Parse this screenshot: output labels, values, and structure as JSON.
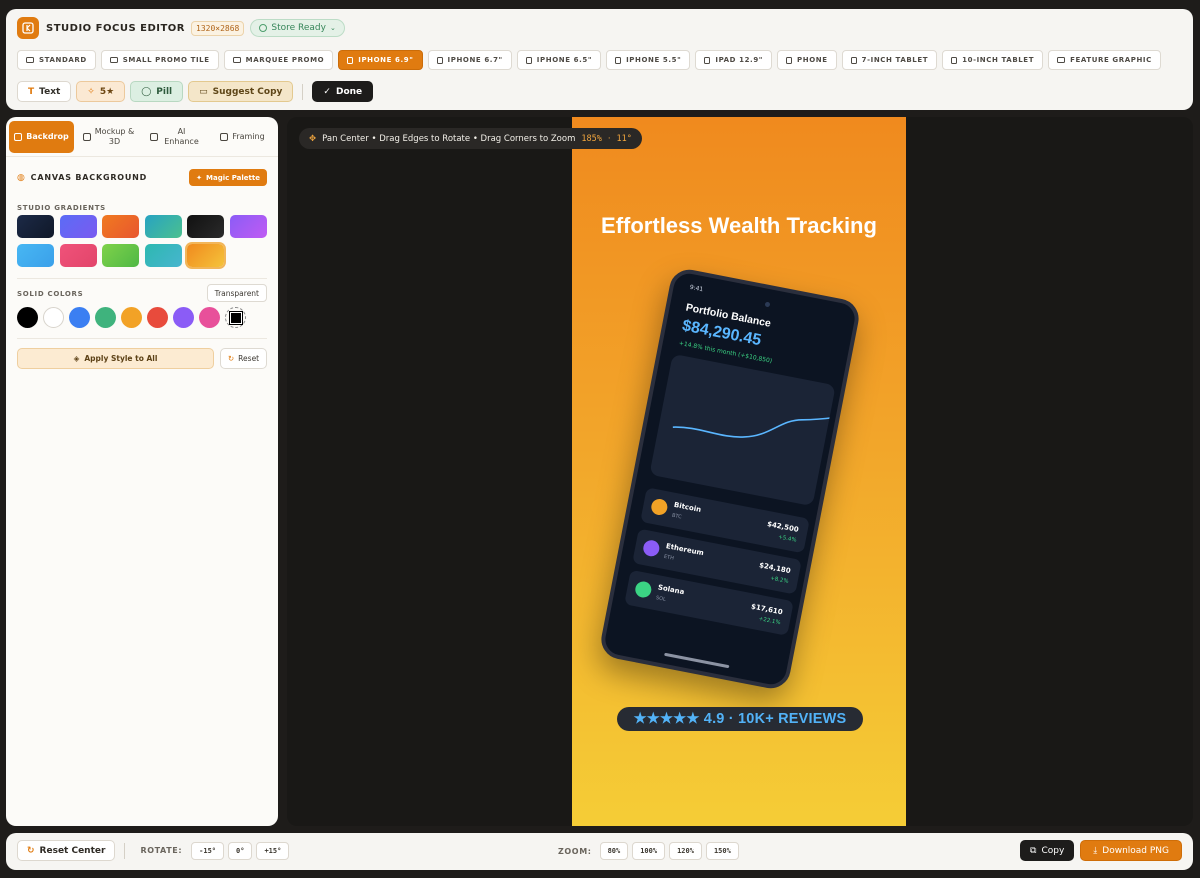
{
  "app": {
    "title": "STUDIO FOCUS EDITOR",
    "dimensions": "1320×2868",
    "store_status": "Store Ready"
  },
  "presets": [
    {
      "label": "STANDARD",
      "icon": "monitor-icon",
      "active": false
    },
    {
      "label": "SMALL PROMO TILE",
      "icon": "monitor-icon",
      "active": false
    },
    {
      "label": "MARQUEE PROMO",
      "icon": "monitor-icon",
      "active": false
    },
    {
      "label": "IPHONE 6.9\"",
      "icon": "phone-icon",
      "active": true
    },
    {
      "label": "IPHONE 6.7\"",
      "icon": "phone-icon",
      "active": false
    },
    {
      "label": "IPHONE 6.5\"",
      "icon": "phone-icon",
      "active": false
    },
    {
      "label": "IPHONE 5.5\"",
      "icon": "phone-icon",
      "active": false
    },
    {
      "label": "IPAD 12.9\"",
      "icon": "tablet-icon",
      "active": false
    },
    {
      "label": "PHONE",
      "icon": "phone-icon",
      "active": false
    },
    {
      "label": "7-INCH TABLET",
      "icon": "phone-icon",
      "active": false
    },
    {
      "label": "10-INCH TABLET",
      "icon": "phone-icon",
      "active": false
    },
    {
      "label": "FEATURE GRAPHIC",
      "icon": "monitor-icon",
      "active": false
    }
  ],
  "toolbar": {
    "text": "Text",
    "rating": "5★",
    "pill": "Pill",
    "suggest_copy": "Suggest Copy",
    "done": "Done"
  },
  "sidebar": {
    "tabs": [
      {
        "label": "Backdrop",
        "icon": "palette-icon",
        "active": true
      },
      {
        "label": "Mockup & 3D",
        "icon": "phone-icon",
        "active": false
      },
      {
        "label": "AI Enhance",
        "icon": "lightning-icon",
        "active": false
      },
      {
        "label": "Framing",
        "icon": "frame-icon",
        "active": false
      }
    ],
    "section_title": "CANVAS BACKGROUND",
    "magic_palette": "Magic Palette",
    "gradients_label": "STUDIO GRADIENTS",
    "gradients": [
      {
        "from": "#1c2a47",
        "to": "#101828",
        "selected": false
      },
      {
        "from": "#5b6cf6",
        "to": "#7a5af0",
        "selected": false
      },
      {
        "from": "#f07a20",
        "to": "#e8562f",
        "selected": false
      },
      {
        "from": "#27a3c2",
        "to": "#4bc08f",
        "selected": false
      },
      {
        "from": "#111",
        "to": "#2a2a2a",
        "selected": false
      },
      {
        "from": "#8b5cf6",
        "to": "#c05bf3",
        "selected": false
      },
      {
        "from": "#48b7f3",
        "to": "#3aa0ea",
        "selected": false
      },
      {
        "from": "#f0527a",
        "to": "#e2456a",
        "selected": false
      },
      {
        "from": "#7fd24a",
        "to": "#4fb845",
        "selected": false
      },
      {
        "from": "#2db8b0",
        "to": "#47b5cf",
        "selected": false
      },
      {
        "from": "#f08a1e",
        "to": "#f5c33a",
        "selected": true
      }
    ],
    "solid_label": "SOLID COLORS",
    "transparent": "Transparent",
    "solid_colors": [
      "#000000",
      "#ffffff",
      "#3b7ff2",
      "#3fb37d",
      "#f2a226",
      "#e84b3c",
      "#8b5cf6",
      "#e8509a"
    ],
    "apply_all": "Apply Style to All",
    "reset": "Reset"
  },
  "canvas": {
    "hint": "Pan Center • Drag Edges to Rotate • Drag Corners to Zoom",
    "zoom": "185%",
    "separator": "·",
    "rotation": "11°",
    "headline": "Effortless Wealth Tracking",
    "phone": {
      "time": "9:41",
      "title": "Portfolio Balance",
      "amount": "$84,290.45",
      "change": "+14.8% this month (+$10,850)",
      "coins": [
        {
          "name": "Bitcoin",
          "symbol": "BTC",
          "value": "$42,500",
          "change": "+5.4%",
          "color": "#f2a226"
        },
        {
          "name": "Ethereum",
          "symbol": "ETH",
          "value": "$24,180",
          "change": "+8.2%",
          "color": "#8b5cf6"
        },
        {
          "name": "Solana",
          "symbol": "SOL",
          "value": "$17,610",
          "change": "+22.1%",
          "color": "#3bd484"
        }
      ]
    },
    "reviews": "★★★★★ 4.9 · 10K+ REVIEWS"
  },
  "bottom": {
    "reset_center": "Reset Center",
    "rotate_label": "ROTATE:",
    "rotate_options": [
      "-15°",
      "0°",
      "+15°"
    ],
    "zoom_label": "ZOOM:",
    "zoom_options": [
      "80%",
      "100%",
      "120%",
      "150%"
    ],
    "copy": "Copy",
    "download": "Download PNG"
  }
}
